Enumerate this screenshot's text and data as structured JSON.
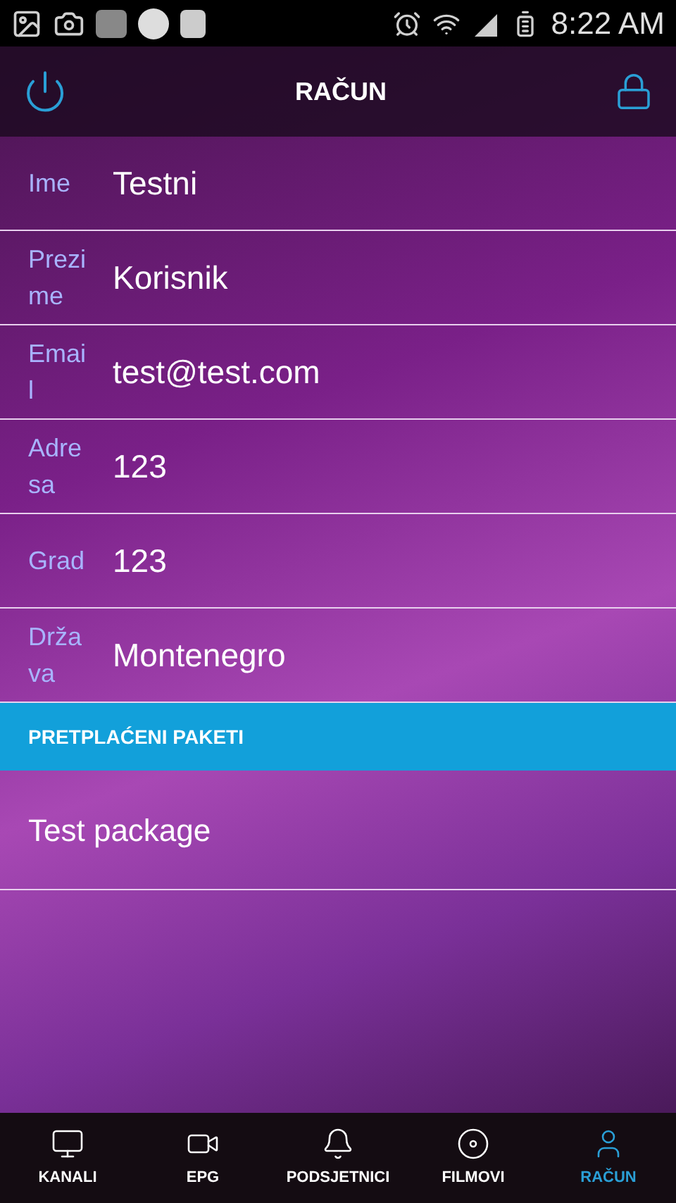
{
  "status_bar": {
    "time": "8:22 AM"
  },
  "header": {
    "title": "RAČUN"
  },
  "fields": [
    {
      "label": "Ime",
      "value": "Testni"
    },
    {
      "label": "Prezime",
      "value": "Korisnik"
    },
    {
      "label": "Email",
      "value": "test@test.com"
    },
    {
      "label": "Adresa",
      "value": "123"
    },
    {
      "label": "Grad",
      "value": "123"
    },
    {
      "label": "Država",
      "value": "Montenegro"
    }
  ],
  "section": {
    "title": "PRETPLAĆENI PAKETI"
  },
  "packages": [
    "Test package"
  ],
  "bottom_nav": [
    {
      "label": "KANALI",
      "selected": false
    },
    {
      "label": "EPG",
      "selected": false
    },
    {
      "label": "PODSJETNICI",
      "selected": false
    },
    {
      "label": "FILMOVI",
      "selected": false
    },
    {
      "label": "RAČUN",
      "selected": true
    }
  ]
}
